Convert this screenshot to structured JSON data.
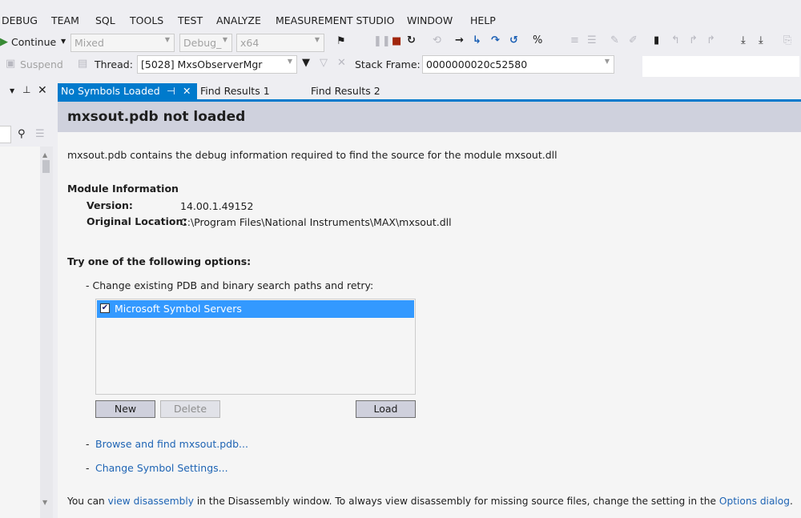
{
  "menu": [
    "DEBUG",
    "TEAM",
    "SQL",
    "TOOLS",
    "TEST",
    "ANALYZE",
    "MEASUREMENT STUDIO",
    "WINDOW",
    "HELP"
  ],
  "toolbar": {
    "continue": "Continue",
    "mode": "Mixed",
    "config": "Debug_",
    "platform": "x64",
    "suspend": "Suspend",
    "thread_label": "Thread:",
    "thread_value": "[5028] MxsObserverMgr",
    "stack_label": "Stack Frame:",
    "stack_value": "0000000020c52580"
  },
  "tabs": [
    {
      "label": "No Symbols Loaded",
      "active": true
    },
    {
      "label": "Find Results 1"
    },
    {
      "label": "Find Results 2"
    }
  ],
  "colors": {
    "accent": "#007acc",
    "selection": "#3399ff",
    "link": "#1e64b4"
  },
  "page": {
    "title": "mxsout.pdb not loaded",
    "intro": "mxsout.pdb contains the debug information required to find the source for the module mxsout.dll",
    "module_heading": "Module Information",
    "version_label": "Version:",
    "version": "14.00.1.49152",
    "location_label": "Original Location:",
    "location": "C:\\Program Files\\National Instruments\\MAX\\mxsout.dll",
    "options_heading": "Try one of the following options:",
    "option1": "- Change existing PDB and binary search paths and retry:",
    "paths": [
      {
        "label": "Microsoft Symbol Servers",
        "checked": true
      }
    ],
    "new": "New",
    "delete": "Delete",
    "load": "Load",
    "browse": "Browse and find mxsout.pdb...",
    "settings": "Change Symbol Settings...",
    "footer_a": "You can ",
    "footer_link1": "view disassembly",
    "footer_b": " in the Disassembly window. To always view disassembly for missing source files, change the setting in the ",
    "footer_link2": "Options dialog",
    "footer_c": "."
  }
}
